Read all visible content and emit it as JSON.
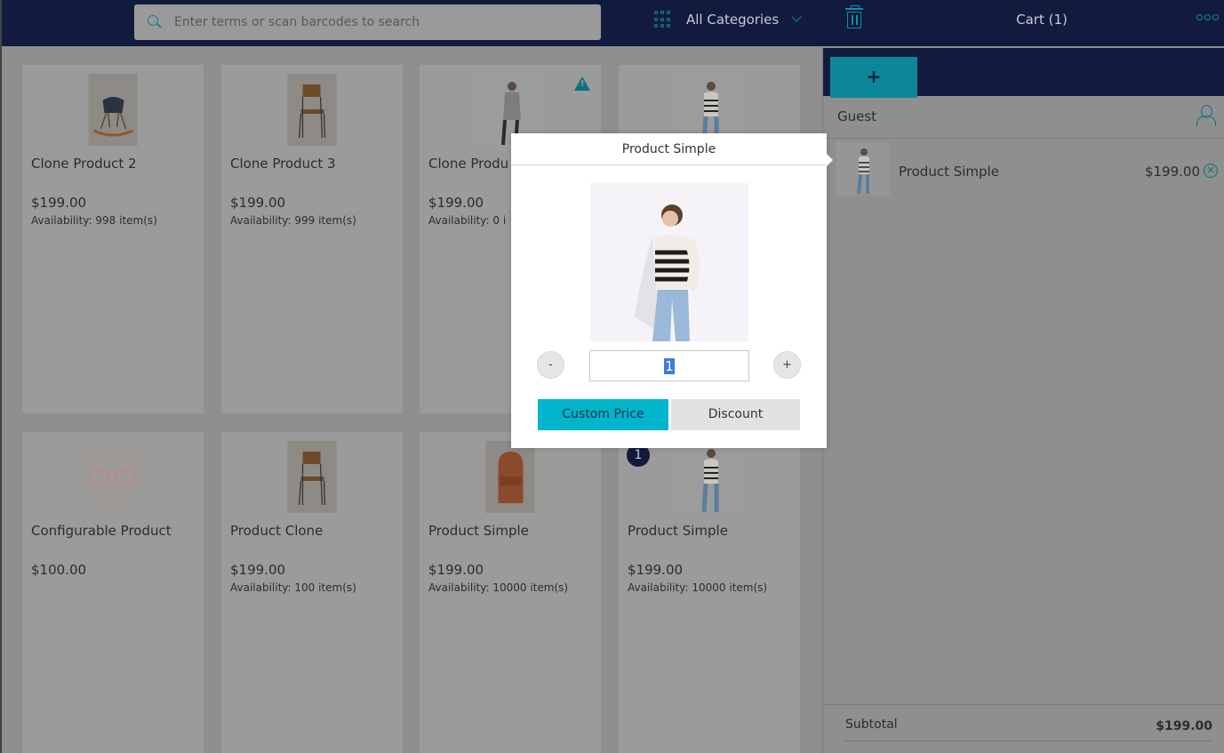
{
  "header": {
    "search_placeholder": "Enter terms or scan barcodes to search",
    "category_label": "All Categories",
    "cart_title": "Cart (1)"
  },
  "products": [
    {
      "name": "Clone Product 2",
      "price": "$199.00",
      "availability": "Availability: 998 item(s)"
    },
    {
      "name": "Clone Product 3",
      "price": "$199.00",
      "availability": "Availability: 999 item(s)"
    },
    {
      "name": "Clone Produ",
      "price": "$199.00",
      "availability": "Availability: 0 i"
    },
    {
      "name": "",
      "price": "",
      "availability": ""
    },
    {
      "name": "Configurable Product",
      "price": "$100.00",
      "availability": ""
    },
    {
      "name": "Product Clone",
      "price": "$199.00",
      "availability": "Availability: 100 item(s)"
    },
    {
      "name": "Product Simple",
      "price": "$199.00",
      "availability": "Availability: 10000 item(s)"
    },
    {
      "name": "Product Simple",
      "price": "$199.00",
      "availability": "Availability: 10000 item(s)",
      "badge": "1"
    }
  ],
  "cart": {
    "add_label": "+",
    "customer": "Guest",
    "items": [
      {
        "name": "Product Simple",
        "price": "$199.00"
      }
    ],
    "subtotal_label": "Subtotal",
    "subtotal_value": "$199.00"
  },
  "modal": {
    "title": "Product Simple",
    "qty_minus": "-",
    "qty_plus": "+",
    "qty_value": "1",
    "custom_price_label": "Custom Price",
    "discount_label": "Discount"
  },
  "colors": {
    "header_bg": "#121a3d",
    "accent": "#00b5cc",
    "overlay": "#8f8f8f"
  },
  "icons": [
    "search-icon",
    "grid-icon",
    "chevron-down-icon",
    "trash-icon",
    "more-icon",
    "warning-icon",
    "user-icon",
    "remove-icon"
  ]
}
